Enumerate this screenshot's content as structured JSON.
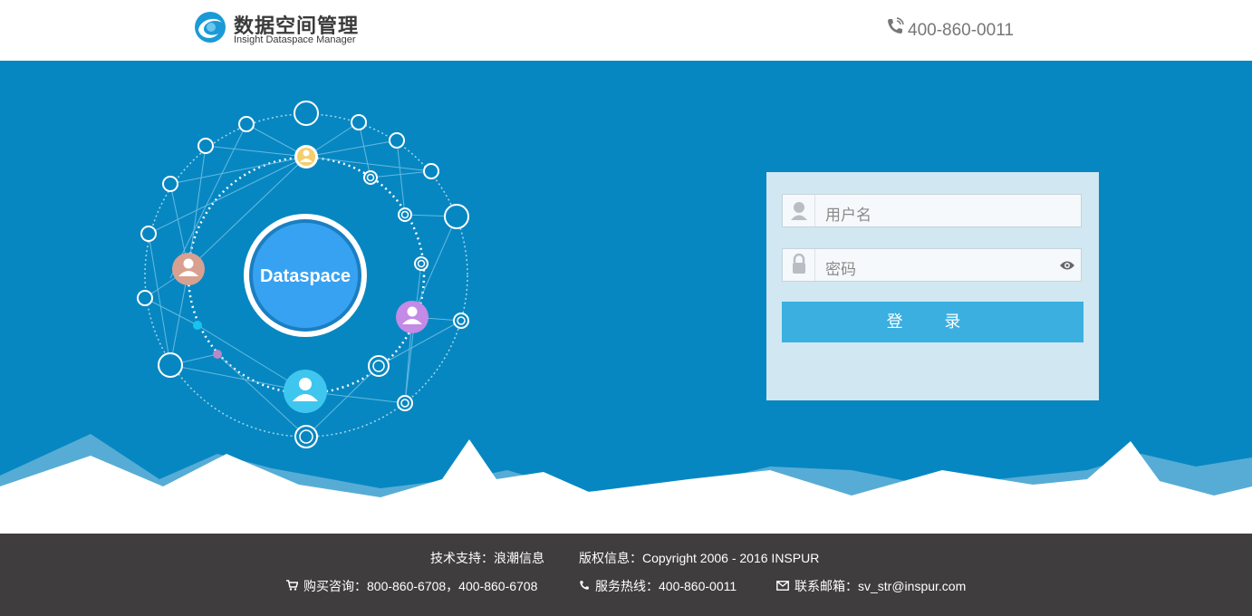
{
  "header": {
    "logo_title": "数据空间管理",
    "logo_subtitle": "Insight Dataspace Manager",
    "phone": "400-860-0011"
  },
  "hero": {
    "center_label": "Dataspace"
  },
  "login": {
    "username_placeholder": "用户名",
    "password_placeholder": "密码",
    "submit_label": "登 录"
  },
  "footer": {
    "tech_support_label": "技术支持：",
    "tech_support_value": "浪潮信息",
    "copyright_label": "版权信息：",
    "copyright_value": "Copyright 2006 - 2016 INSPUR",
    "purchase_label": "购买咨询：",
    "purchase_value": "800-860-6708，400-860-6708",
    "hotline_label": "服务热线：",
    "hotline_value": "400-860-0011",
    "email_label": "联系邮箱：",
    "email_value": "sv_str@inspur.com"
  },
  "colors": {
    "hero_bg": "#0787c1",
    "login_panel": "#d1e7f2",
    "button": "#3aafe0",
    "footer_bg": "#3f3d3e"
  },
  "icons": [
    "logo-icon",
    "phone-icon",
    "user-icon",
    "lock-icon",
    "eye-icon",
    "cart-icon",
    "email-icon"
  ]
}
